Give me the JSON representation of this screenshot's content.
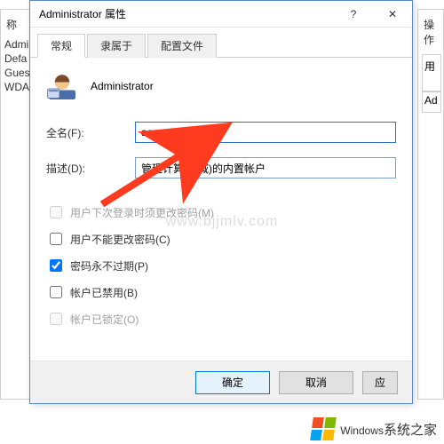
{
  "dialog": {
    "title": "Administrator 属性",
    "help_icon": "?",
    "close_icon": "✕"
  },
  "tabs": {
    "general": "常规",
    "memberof": "隶属于",
    "profile": "配置文件"
  },
  "identity": {
    "username": "Administrator"
  },
  "fields": {
    "fullname_label": "全名(F):",
    "fullname_value": "aas",
    "description_label": "描述(D):",
    "description_value": "管理计算机(域)的内置帐户"
  },
  "checkboxes": {
    "must_change": "用户下次登录时须更改密码(M)",
    "cannot_change": "用户不能更改密码(C)",
    "never_expire": "密码永不过期(P)",
    "disabled": "帐户已禁用(B)",
    "locked": "帐户已锁定(O)"
  },
  "buttons": {
    "ok": "确定",
    "cancel": "取消",
    "apply": "应"
  },
  "bg_left": {
    "header": "称",
    "items": [
      "Admi",
      "Defa",
      "Gues",
      "WDA"
    ]
  },
  "bg_right": {
    "header": "操作",
    "c1": "用",
    "c2": "Ad"
  },
  "watermark": "www.bjjmlv.com",
  "footer": {
    "brand": "Windows",
    "suffix": "系统之家"
  }
}
